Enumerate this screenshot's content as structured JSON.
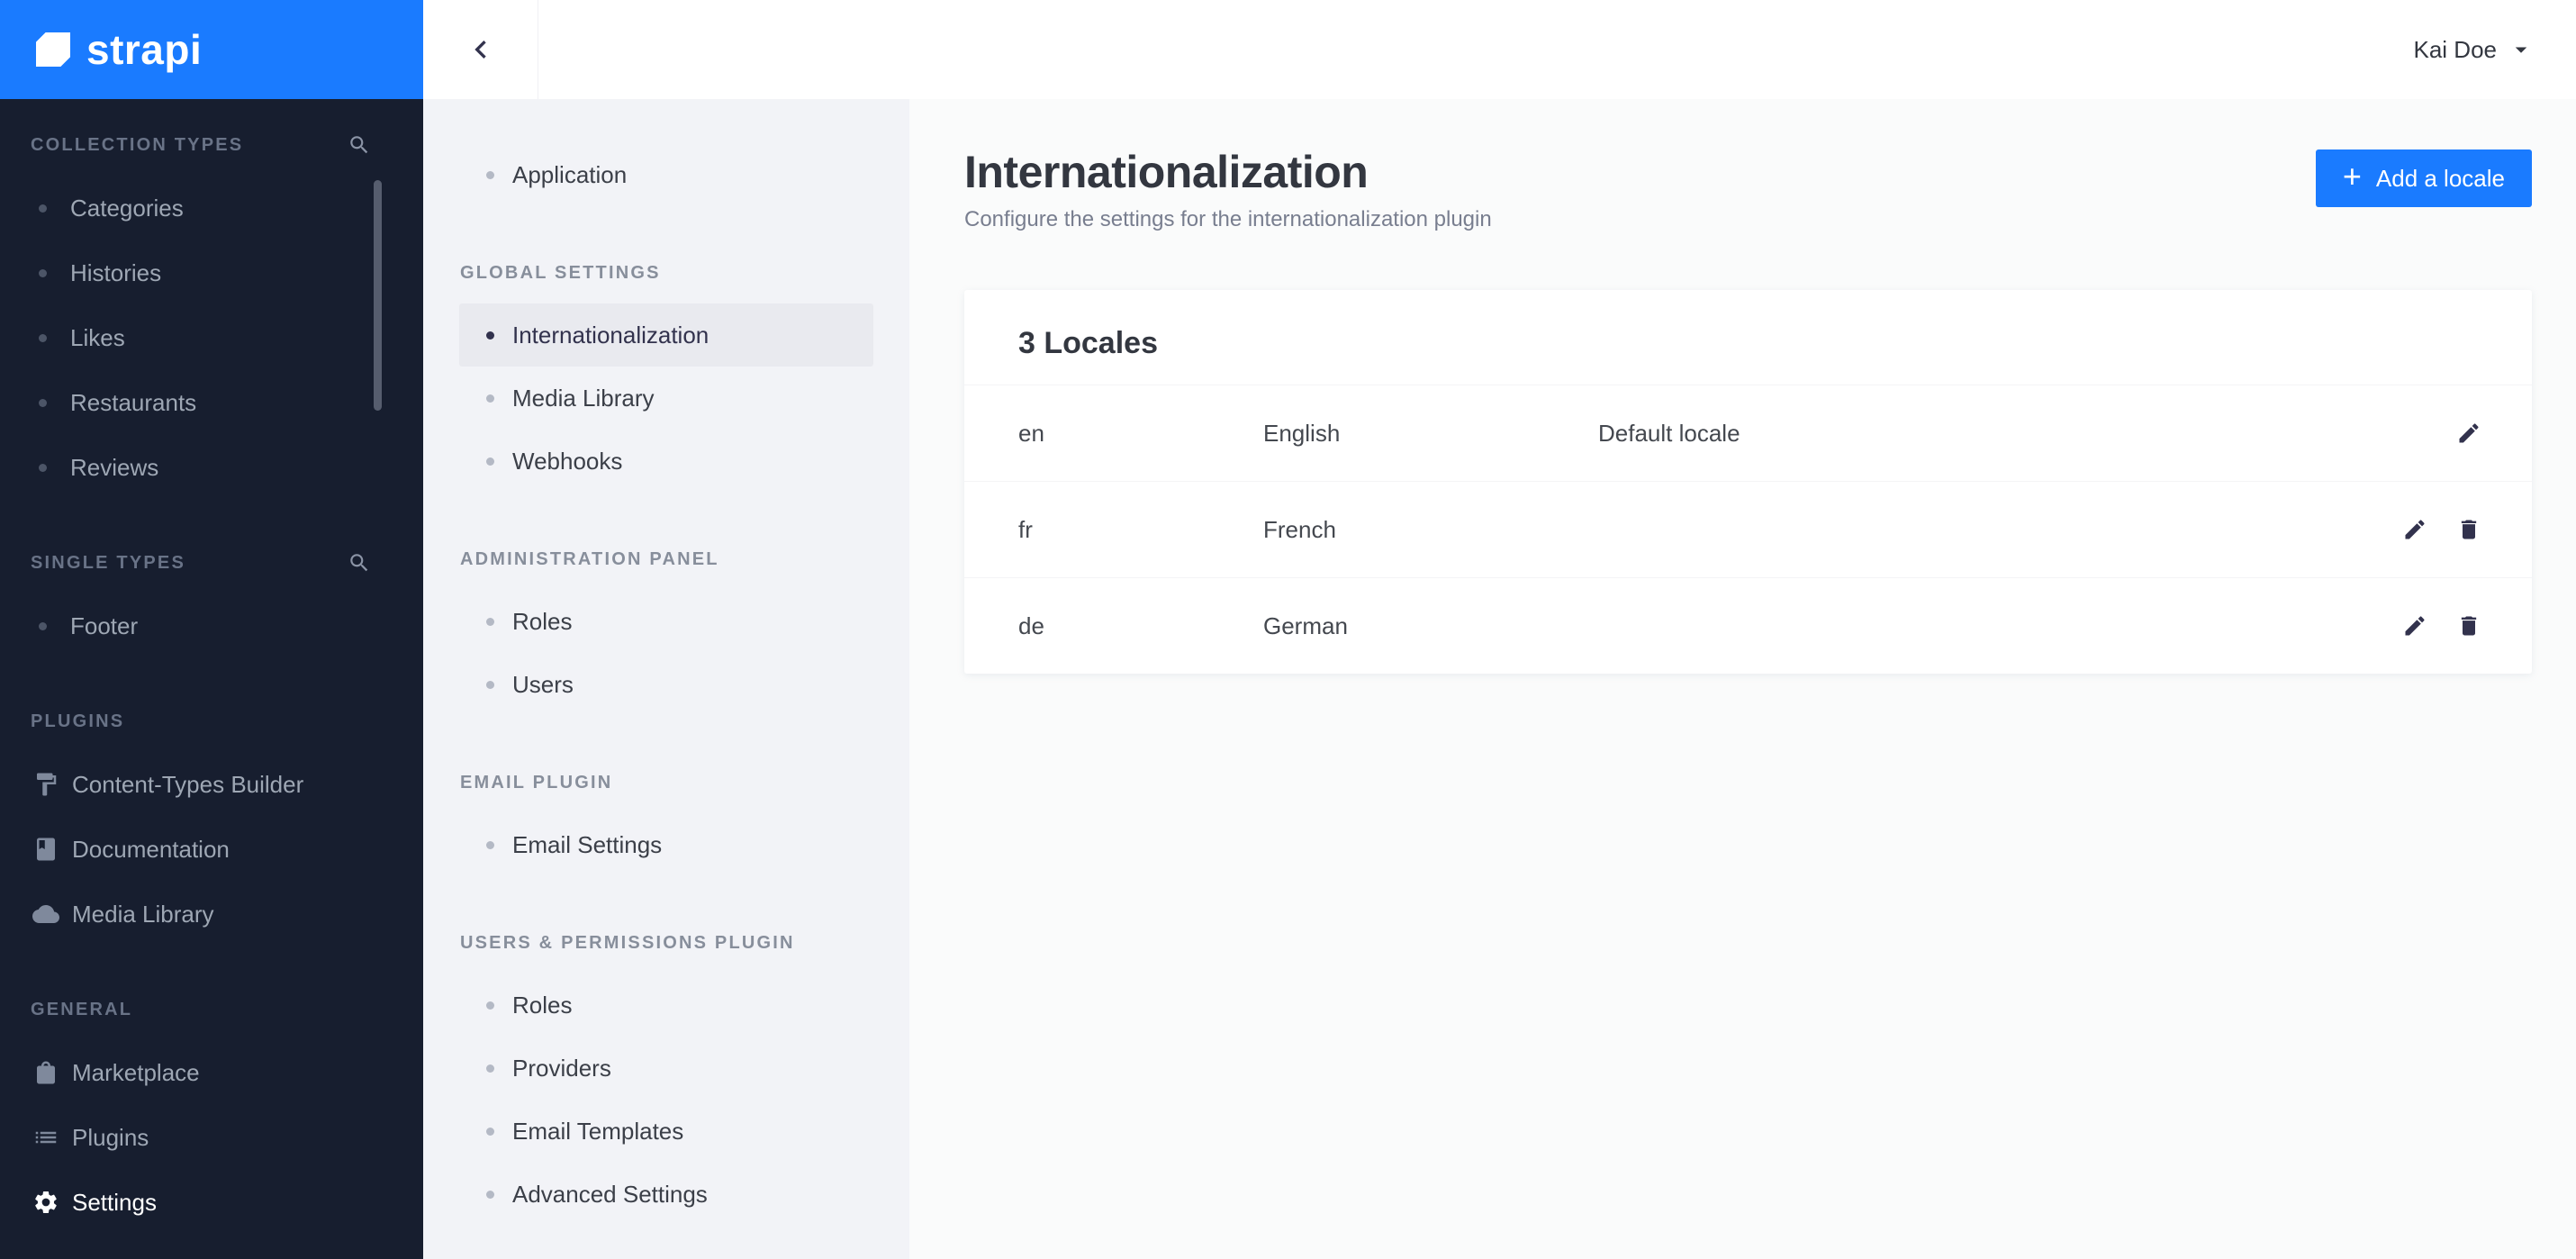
{
  "colors": {
    "accent": "#1a7bff",
    "sidebar_bg": "#171e2f",
    "subnav_bg": "#f2f3f7",
    "active_item_bg": "#e9eaef"
  },
  "brand": {
    "logo_text": "strapi"
  },
  "topbar": {
    "user_name": "Kai Doe"
  },
  "sidebar": {
    "sections": [
      {
        "title": "COLLECTION TYPES",
        "items": [
          {
            "label": "Categories"
          },
          {
            "label": "Histories"
          },
          {
            "label": "Likes"
          },
          {
            "label": "Restaurants"
          },
          {
            "label": "Reviews"
          }
        ]
      },
      {
        "title": "SINGLE TYPES",
        "items": [
          {
            "label": "Footer"
          }
        ]
      },
      {
        "title": "PLUGINS",
        "items": [
          {
            "label": "Content-Types Builder"
          },
          {
            "label": "Documentation"
          },
          {
            "label": "Media Library"
          }
        ]
      },
      {
        "title": "GENERAL",
        "items": [
          {
            "label": "Marketplace"
          },
          {
            "label": "Plugins"
          },
          {
            "label": "Settings"
          }
        ]
      }
    ]
  },
  "settings_nav": {
    "standalone": {
      "label": "Application"
    },
    "sections": [
      {
        "title": "GLOBAL SETTINGS",
        "items": [
          {
            "label": "Internationalization"
          },
          {
            "label": "Media Library"
          },
          {
            "label": "Webhooks"
          }
        ]
      },
      {
        "title": "ADMINISTRATION PANEL",
        "items": [
          {
            "label": "Roles"
          },
          {
            "label": "Users"
          }
        ]
      },
      {
        "title": "EMAIL PLUGIN",
        "items": [
          {
            "label": "Email Settings"
          }
        ]
      },
      {
        "title": "USERS & PERMISSIONS PLUGIN",
        "items": [
          {
            "label": "Roles"
          },
          {
            "label": "Providers"
          },
          {
            "label": "Email Templates"
          },
          {
            "label": "Advanced Settings"
          }
        ]
      }
    ]
  },
  "main": {
    "title": "Internationalization",
    "subtitle": "Configure the settings for the internationalization plugin",
    "add_button": {
      "plus": "+",
      "label": "Add a locale"
    },
    "card": {
      "title": "3 Locales",
      "rows": [
        {
          "code": "en",
          "name": "English",
          "note": "Default locale"
        },
        {
          "code": "fr",
          "name": "French",
          "note": ""
        },
        {
          "code": "de",
          "name": "German",
          "note": ""
        }
      ]
    }
  }
}
